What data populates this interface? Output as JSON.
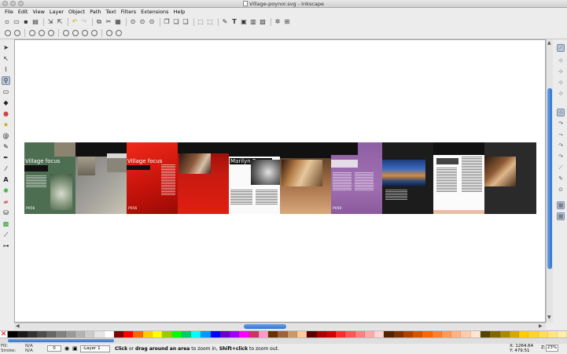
{
  "window": {
    "title": "Village-poynor.svg - Inkscape"
  },
  "menu": [
    "File",
    "Edit",
    "View",
    "Layer",
    "Object",
    "Path",
    "Text",
    "Filters",
    "Extensions",
    "Help"
  ],
  "document": {
    "pages": [
      {
        "heading": "Village focus",
        "footer": "P056"
      },
      {
        "heading": "Village focus",
        "footer": "P056"
      },
      {
        "heading": "Marilyn Poynor"
      },
      {
        "footer": "P056"
      }
    ]
  },
  "palette_colors": [
    "#000000",
    "#1a1a1a",
    "#333333",
    "#4d4d4d",
    "#666666",
    "#808080",
    "#999999",
    "#b3b3b3",
    "#cccccc",
    "#e6e6e6",
    "#ffffff",
    "#800000",
    "#ff0000",
    "#ff6600",
    "#ffcc00",
    "#ffff00",
    "#99cc00",
    "#00ff00",
    "#00cc66",
    "#00ffff",
    "#0099ff",
    "#0000ff",
    "#6600cc",
    "#9900ff",
    "#ff00ff",
    "#cc3366",
    "#ff99cc",
    "#663300",
    "#996633",
    "#cc9966",
    "#ffcc99",
    "#550000",
    "#aa0000",
    "#d40000",
    "#ff2a2a",
    "#ff5555",
    "#ff8080",
    "#ffaaaa",
    "#ffd5d5",
    "#552200",
    "#803300",
    "#aa4400",
    "#d45500",
    "#ff6600",
    "#ff7f2a",
    "#ff9955",
    "#ffb380",
    "#ffccaa",
    "#ffe6d5",
    "#554400",
    "#806600",
    "#aa8800",
    "#d4aa00",
    "#ffcc00",
    "#ffd42a",
    "#ffdd55",
    "#ffe680",
    "#ffeeaa"
  ],
  "status": {
    "fill_label": "Fill:",
    "stroke_label": "Stroke:",
    "fill_value": "N/A",
    "stroke_value": "N/A",
    "opacity": "0",
    "layer": "-Layer 1",
    "message_bold_1": "Click",
    "message_1": " or ",
    "message_bold_2": "drag around an area",
    "message_2": " to zoom in, ",
    "message_bold_3": "Shift+click",
    "message_3": " to zoom out.",
    "x_label": "X:",
    "x_value": "1264.64",
    "y_label": "Y:",
    "y_value": "479.51",
    "zoom_label": "Z:",
    "zoom_value": "23%"
  }
}
